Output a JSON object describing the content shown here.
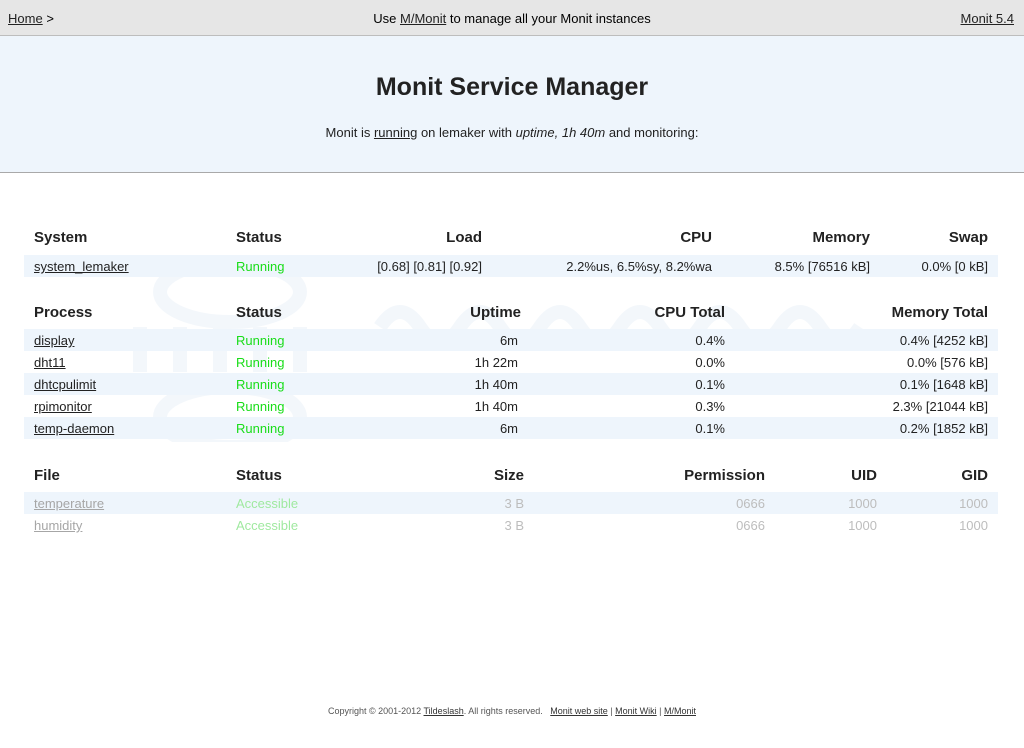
{
  "nav": {
    "home_link": "Home",
    "separator": ">",
    "center_prefix": "Use ",
    "center_link": "M/Monit",
    "center_suffix": " to manage all your Monit instances",
    "version_link": "Monit 5.4"
  },
  "header": {
    "title": "Monit Service Manager",
    "status_prefix": "Monit is ",
    "status_link": "running",
    "status_middle": " on lemaker with ",
    "status_uptime": "uptime, 1h 40m",
    "status_suffix": "  and monitoring:"
  },
  "system_table": {
    "headers": [
      "System",
      "Status",
      "Load",
      "CPU",
      "Memory",
      "Swap"
    ],
    "rows": [
      {
        "name": "system_lemaker",
        "status": "Running",
        "load": "[0.68] [0.81] [0.92]",
        "cpu": "2.2%us, 6.5%sy, 8.2%wa",
        "memory": "8.5% [76516 kB]",
        "swap": "0.0% [0 kB]"
      }
    ]
  },
  "process_table": {
    "headers": [
      "Process",
      "Status",
      "Uptime",
      "CPU Total",
      "Memory Total"
    ],
    "rows": [
      {
        "name": "display",
        "status": "Running",
        "uptime": "6m",
        "cpu": "0.4%",
        "memory": "0.4% [4252 kB]"
      },
      {
        "name": "dht11",
        "status": "Running",
        "uptime": "1h 22m",
        "cpu": "0.0%",
        "memory": "0.0% [576 kB]"
      },
      {
        "name": "dhtcpulimit",
        "status": "Running",
        "uptime": "1h 40m",
        "cpu": "0.1%",
        "memory": "0.1% [1648 kB]"
      },
      {
        "name": "rpimonitor",
        "status": "Running",
        "uptime": "1h 40m",
        "cpu": "0.3%",
        "memory": "2.3% [21044 kB]"
      },
      {
        "name": "temp-daemon",
        "status": "Running",
        "uptime": "6m",
        "cpu": "0.1%",
        "memory": "0.2% [1852 kB]"
      }
    ]
  },
  "file_table": {
    "headers": [
      "File",
      "Status",
      "Size",
      "Permission",
      "UID",
      "GID"
    ],
    "rows": [
      {
        "name": "temperature",
        "status": "Accessible",
        "size": "3 B",
        "permission": "0666",
        "uid": "1000",
        "gid": "1000"
      },
      {
        "name": "humidity",
        "status": "Accessible",
        "size": "3 B",
        "permission": "0666",
        "uid": "1000",
        "gid": "1000"
      }
    ]
  },
  "footer": {
    "copyright": "Copyright © 2001-2012 ",
    "company_link": "Tildeslash",
    "rights": ". All rights reserved.",
    "website_link": "Monit web site",
    "sep1": " | ",
    "wiki_link": "Monit Wiki",
    "sep2": " | ",
    "mmonit_link": "M/Monit"
  },
  "colors": {
    "running": "#19dd19",
    "header_bg": "#eef5fc",
    "nav_bg": "#e6e6e6"
  }
}
